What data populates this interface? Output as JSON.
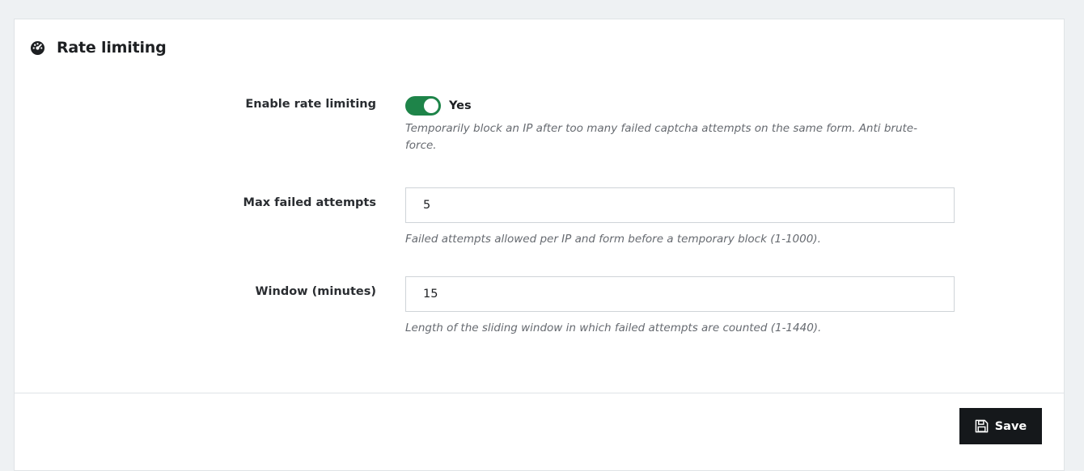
{
  "section": {
    "title": "Rate limiting",
    "icon": "speedometer-icon"
  },
  "fields": {
    "enable": {
      "label": "Enable rate limiting",
      "toggle_on": true,
      "toggle_text": "Yes",
      "help": "Temporarily block an IP after too many failed captcha attempts on the same form. Anti brute-force."
    },
    "max_attempts": {
      "label": "Max failed attempts",
      "value": "5",
      "help": "Failed attempts allowed per IP and form before a temporary block (1-1000)."
    },
    "window": {
      "label": "Window (minutes)",
      "value": "15",
      "help": "Length of the sliding window in which failed attempts are counted (1-1440)."
    }
  },
  "footer": {
    "save_label": "Save",
    "save_icon": "floppy-disk-icon"
  },
  "colors": {
    "toggle_on": "#1e8449",
    "button_bg": "#15181b"
  }
}
